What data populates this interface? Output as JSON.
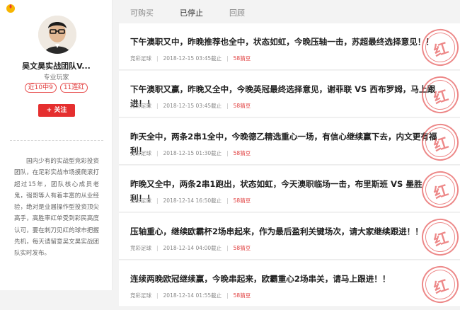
{
  "sidebar": {
    "logo_icon": "app-logo-icon",
    "author_name": "吴文昊实战团队V...",
    "author_title": "专业玩家",
    "badges": [
      "近10中9",
      "11连红"
    ],
    "follow_label": "+ 关注",
    "bio": "国内少有的实战型竞彩投资团队，在足彩实战市场摸爬滚打超过15年，团队核心成员老鬼，强哥等人有着丰富的从业经验，绝对是业届操作型投资顶尖高手，高胜率红单受到彩民高度认可，要在刺刀见红的球市把握先机，每天请留意吴文昊实战团队实时发布。"
  },
  "tabs": [
    {
      "label": "可购买",
      "active": false
    },
    {
      "label": "已停止",
      "active": true
    },
    {
      "label": "回顾",
      "active": false
    }
  ],
  "posts": [
    {
      "title": "下午澳职又中，昨晚推荐也全中，状态如虹，今晚压轴一击，苏超最终选择意见！！",
      "category": "竞彩足球",
      "datetime": "2018-12-15 03:45截止",
      "price": "58猜豆",
      "stamp": "红"
    },
    {
      "title": "下午澳职又赢，昨晚又全中，今晚英冠最终选择意见，谢菲联 VS 西布罗姆，马上跟进！！",
      "category": "竞彩足球",
      "datetime": "2018-12-15 03:45截止",
      "price": "58猜豆",
      "stamp": "红"
    },
    {
      "title": "昨天全中，两条2串1全中，今晚德乙精选重心一场，有信心继续赢下去，内文更有福利！",
      "category": "竞彩足球",
      "datetime": "2018-12-15 01:30截止",
      "price": "58猜豆",
      "stamp": "红"
    },
    {
      "title": "昨晚又全中，两条2串1跑出，状态如虹，今天澳职临场一击，布里斯班 VS 墨胜利！！",
      "category": "竞彩足球",
      "datetime": "2018-12-14 16:50截止",
      "price": "58猜豆",
      "stamp": "红"
    },
    {
      "title": "压轴重心，继续欧霸杯2场串起来，作为最后盈利关键场次，请大家继续跟进！！",
      "category": "竞彩足球",
      "datetime": "2018-12-14 04:00截止",
      "price": "58猜豆",
      "stamp": "红"
    },
    {
      "title": "连续两晚欧冠继续赢，今晚串起来，欧霸重心2场串关，请马上跟进！！",
      "category": "竞彩足球",
      "datetime": "2018-12-14 01:55截止",
      "price": "58猜豆",
      "stamp": "红"
    }
  ]
}
